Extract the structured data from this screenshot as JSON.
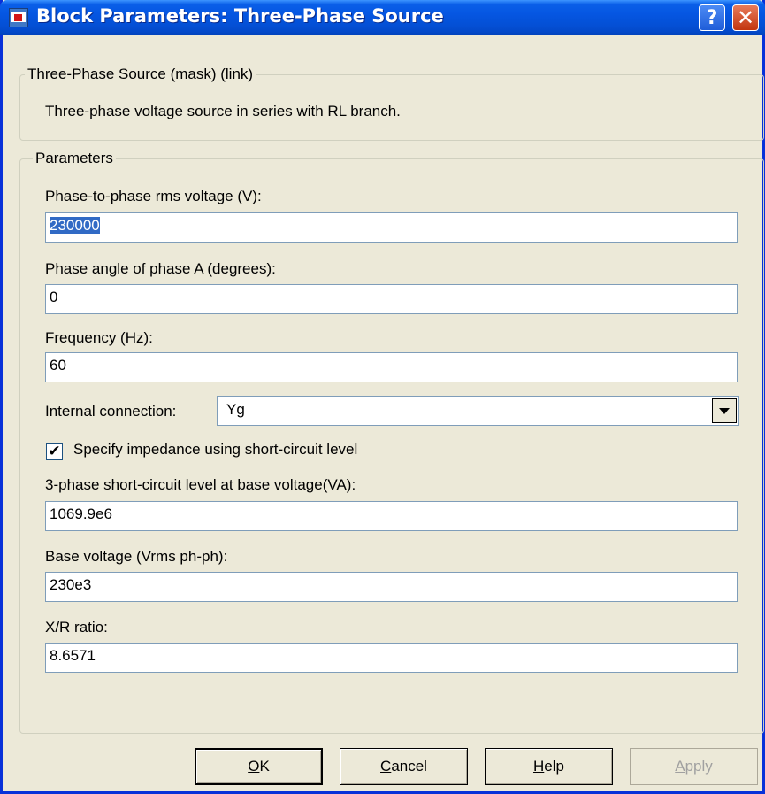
{
  "window": {
    "title": "Block Parameters: Three-Phase Source",
    "help_symbol": "?",
    "close_symbol": "✕"
  },
  "description_group": {
    "legend": "Three-Phase Source (mask) (link)",
    "text": "Three-phase voltage source in series with RL branch."
  },
  "parameters": {
    "legend": "Parameters",
    "fields": [
      {
        "label": "Phase-to-phase rms voltage (V):",
        "value": "230000"
      },
      {
        "label": "Phase angle of phase A (degrees):",
        "value": "0"
      },
      {
        "label": "Frequency (Hz):",
        "value": "60"
      },
      {
        "label": "3-phase short-circuit level at base voltage(VA):",
        "value": "1069.9e6"
      },
      {
        "label": "Base voltage (Vrms ph-ph):",
        "value": "230e3"
      },
      {
        "label": "X/R ratio:",
        "value": "8.6571"
      }
    ],
    "internal_connection": {
      "label": "Internal connection:",
      "value": "Yg"
    },
    "specify_impedance": {
      "label": "Specify impedance using short-circuit level",
      "checked": true,
      "mark": "✔"
    }
  },
  "buttons": {
    "ok": {
      "mnemonic": "O",
      "rest": "K"
    },
    "cancel": {
      "mnemonic": "C",
      "rest": "ancel"
    },
    "help": {
      "mnemonic": "H",
      "rest": "elp"
    },
    "apply": {
      "mnemonic": "A",
      "rest": "pply"
    }
  }
}
